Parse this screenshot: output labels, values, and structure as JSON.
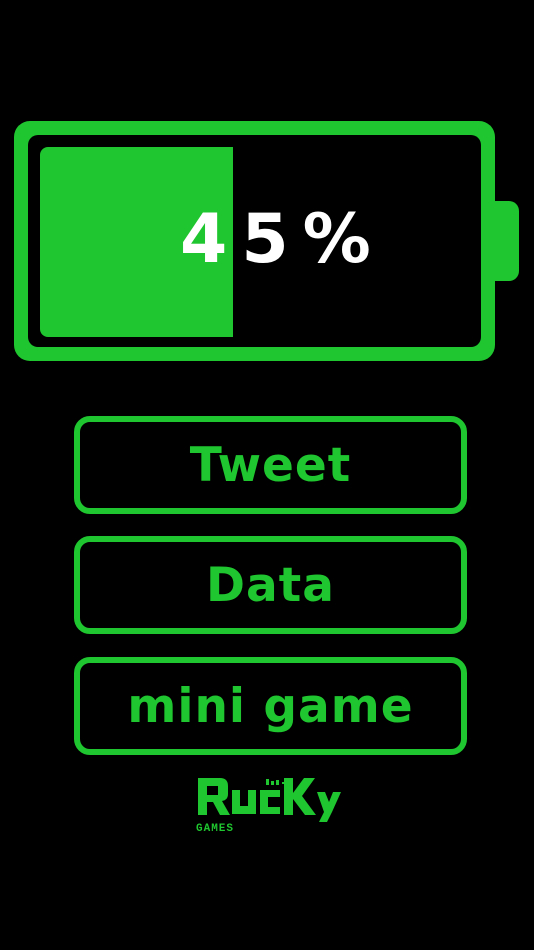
{
  "battery": {
    "level_percent": 45,
    "digit_1": "4",
    "digit_2": "5",
    "unit": "%"
  },
  "menu": {
    "tweet_label": "Tweet",
    "data_label": "Data",
    "mini_game_label": "mini game"
  },
  "logo": {
    "main": "RucKy",
    "katakana": "ラッキー",
    "subtitle": "GAMES"
  },
  "colors": {
    "background": "#000000",
    "accent_green": "#1fc62f",
    "readout_white": "#ffffff"
  },
  "icons": [
    "battery-icon",
    "brand-logo"
  ]
}
